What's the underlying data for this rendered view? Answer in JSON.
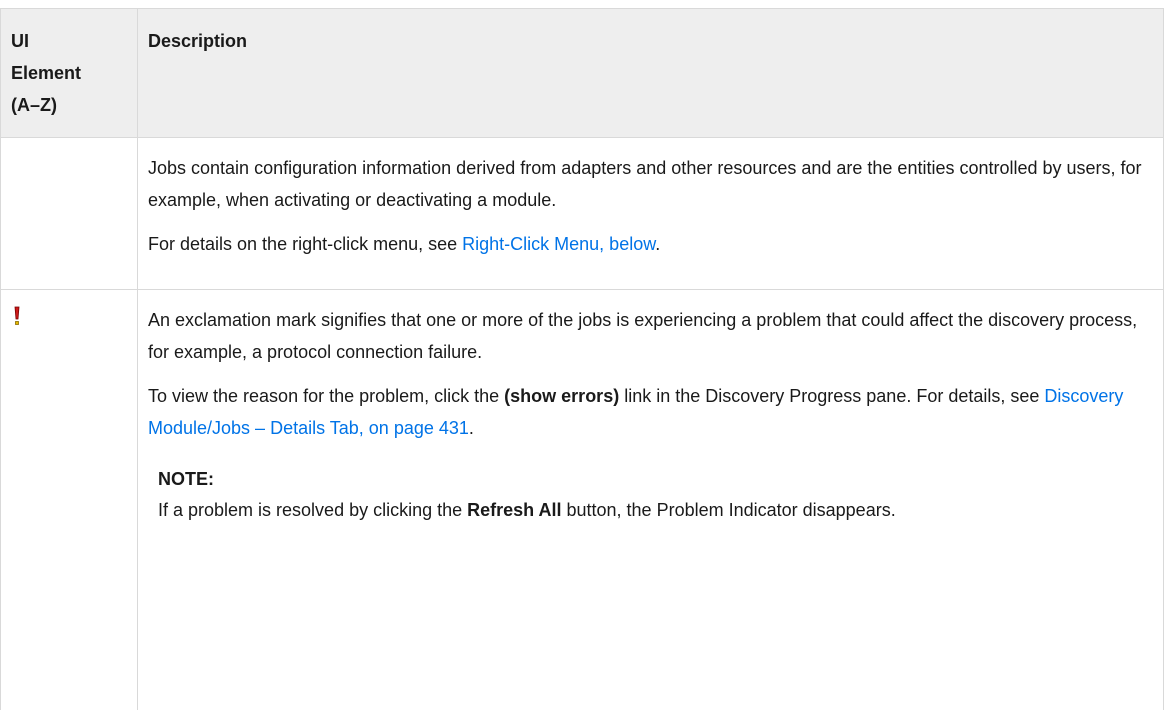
{
  "table": {
    "header": {
      "col_a": [
        "UI",
        "Element",
        "(A–Z)"
      ],
      "col_b": "Description"
    },
    "rows": [
      {
        "icon": "",
        "paragraphs": [
          {
            "text": "Jobs contain configuration information derived from adapters and other resources and are the entities controlled by users, for example, when activating or deactivating a module."
          },
          {
            "prefix": "For details on the right-click menu, see ",
            "link": "Right-Click Menu, below",
            "suffix": "."
          }
        ]
      },
      {
        "icon": "exclamation-mark-icon",
        "paragraphs": [
          {
            "text": "An exclamation mark signifies that one or more of the jobs is experiencing a problem that could affect the discovery process, for example, a protocol connection failure."
          },
          {
            "prefix": "To view the reason for the problem, click the ",
            "bold": "(show errors)",
            "middle": " link in the Discovery Progress pane. For details, see ",
            "link": "Discovery Module/Jobs – Details Tab, on page 431",
            "suffix": "."
          }
        ],
        "note": {
          "title": "NOTE:",
          "prefix": "If a problem is resolved by clicking the ",
          "bold": "Refresh All",
          "suffix": " button, the Problem Indicator disappears."
        }
      }
    ]
  },
  "colors": {
    "link": "#0073e7",
    "header_bg": "#eeeeee",
    "border": "#d9d9d9",
    "icon_red": "#cc1a1a",
    "icon_yellow": "#e6b800"
  }
}
